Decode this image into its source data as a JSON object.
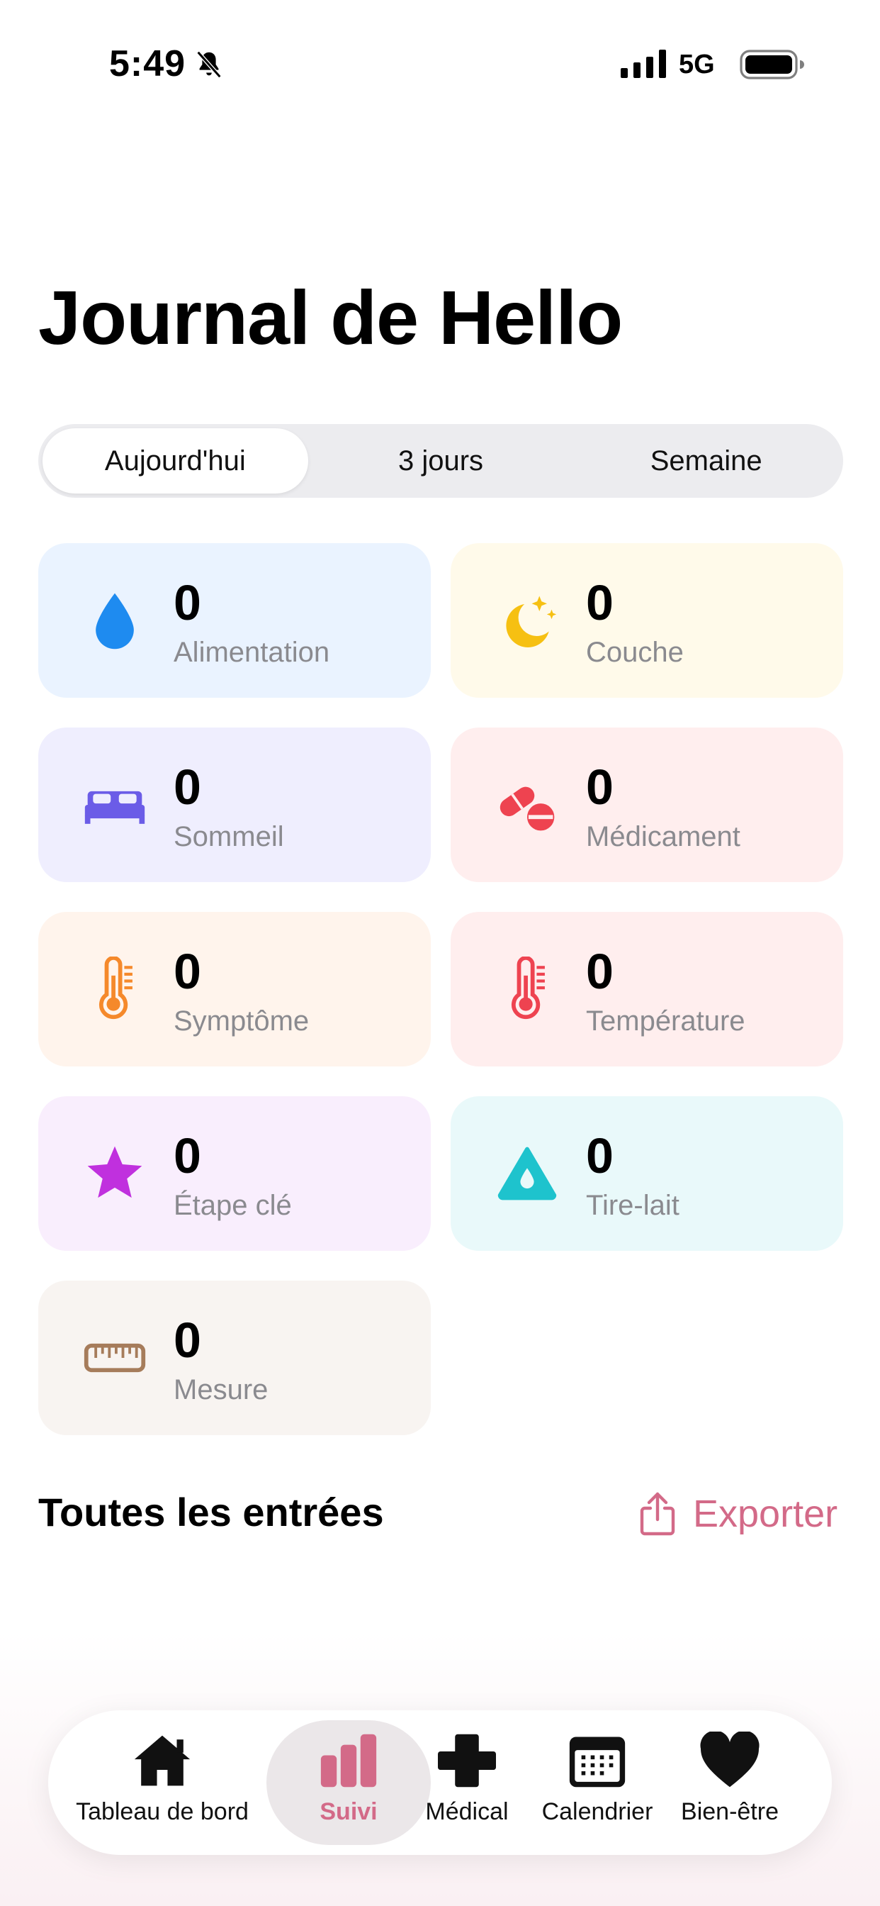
{
  "status_bar": {
    "time": "5:49",
    "network": "5G",
    "icons": [
      "bell-off-icon",
      "signal-icon",
      "battery-icon"
    ]
  },
  "title": "Journal de Hello",
  "segments": {
    "items": [
      "Aujourd'hui",
      "3 jours",
      "Semaine"
    ],
    "selected": "Aujourd'hui"
  },
  "cards": [
    {
      "label": "Alimentation",
      "count": "0",
      "icon": "drop-icon",
      "bg": "#eaf3ff",
      "color": "#1e8bf0"
    },
    {
      "label": "Couche",
      "count": "0",
      "icon": "moon-stars-icon",
      "bg": "#fffaea",
      "color": "#f6c012"
    },
    {
      "label": "Sommeil",
      "count": "0",
      "icon": "bed-icon",
      "bg": "#efeefe",
      "color": "#6b5ce7"
    },
    {
      "label": "Médicament",
      "count": "0",
      "icon": "pills-icon",
      "bg": "#ffeeee",
      "color": "#ee4350"
    },
    {
      "label": "Symptôme",
      "count": "0",
      "icon": "thermometer-icon",
      "bg": "#fff4ec",
      "color": "#f5892b"
    },
    {
      "label": "Température",
      "count": "0",
      "icon": "thermometer-icon",
      "bg": "#ffeeee",
      "color": "#ee4350"
    },
    {
      "label": "Étape clé",
      "count": "0",
      "icon": "star-icon",
      "bg": "#f9eefd",
      "color": "#c030de"
    },
    {
      "label": "Tire-lait",
      "count": "0",
      "icon": "drop-triangle-icon",
      "bg": "#e9f9fa",
      "color": "#1ec3cd"
    },
    {
      "label": "Mesure",
      "count": "0",
      "icon": "ruler-icon",
      "bg": "#f8f4f1",
      "color": "#a67c5b"
    }
  ],
  "section": {
    "title": "Toutes les entrées",
    "export_label": "Exporter"
  },
  "tab_bar": {
    "active": "Suivi",
    "tabs": [
      {
        "label": "Tableau de bord",
        "icon": "home-icon"
      },
      {
        "label": "Suivi",
        "icon": "bar-chart-icon"
      },
      {
        "label": "Médical",
        "icon": "medical-cross-icon"
      },
      {
        "label": "Calendrier",
        "icon": "calendar-icon"
      },
      {
        "label": "Bien-être",
        "icon": "heart-icon"
      }
    ]
  },
  "colors": {
    "accent": "#d36a88",
    "segment_bg": "#ececef",
    "secondary_text": "#8a8a8f"
  }
}
